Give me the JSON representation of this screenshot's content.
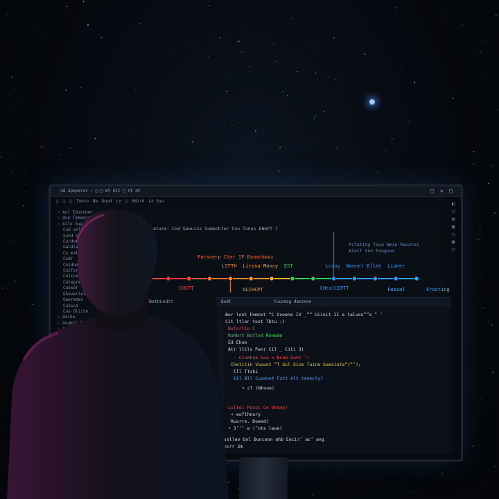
{
  "colors": {
    "background": "#05080d",
    "monitor_bg": "#0a0e15",
    "timeline_red": "#ff3b3b",
    "timeline_orange": "#ff8a2a",
    "timeline_green": "#2ed15a",
    "timeline_blue": "#2c9bff",
    "code_yellow": "#e8d24a",
    "code_green": "#48d66a",
    "code_red": "#ff4a4a",
    "code_blue": "#4fa6ff"
  },
  "window": {
    "title": "3d Spoperos  ‹  □  □ mt mit  □ nt mt",
    "controls": [
      "□",
      "✕",
      "□"
    ]
  },
  "toolbar": {
    "items": [
      "□",
      "□",
      "□",
      "Tooco",
      "Ba",
      "Buud",
      "Lo",
      "□",
      "Md/ch",
      "Lo Suu"
    ]
  },
  "tree": {
    "items": [
      "› Aul Idustnen",
      "› Uun Tomaers",
      "› Gilo Suar",
      "Cud selirs",
      "Sund Spoi",
      "Curdor",
      "Galdls",
      "Co mat",
      "Cudr",
      "Cuidoe",
      "Cuifore",
      "Cuirpas",
      "Catepre",
      "Cuoser",
      "Ghaveclet",
      "Gaeredes",
      "Cuisca",
      "Cuo Gliitn",
      "› Dalbe",
      "› Uuabtt Fiant",
      "› Cuin",
      "› Ludre"
    ]
  },
  "breadcrumb": "Feature: Cod  Gaouiss  Sumeohtor Cou  Tunes  EBAPT ]",
  "graph": {
    "title": "Fursoerp Cter  IF  Eunarkmaz",
    "note": [
      "Fstating Tsun Nmin Racotes",
      "Atalf Sun Fongnes"
    ],
    "nodes": [
      {
        "label": "",
        "color": "#ff3b3b"
      },
      {
        "label": "",
        "color": "#ff3b3b"
      },
      {
        "label": "",
        "color": "#ff5a3a"
      },
      {
        "label": "",
        "color": "#ff7a2a"
      },
      {
        "label": "LSTTH",
        "color": "#ff8a2a"
      },
      {
        "label": "Lirssa",
        "color": "#ff9a2a"
      },
      {
        "label": "Moncy",
        "color": "#ffb02a"
      },
      {
        "label": "EST",
        "color": "#2ed15a"
      },
      {
        "label": "",
        "color": "#2ed15a"
      },
      {
        "label": "Lcooy",
        "color": "#2c9bff"
      },
      {
        "label": "Nonnel",
        "color": "#2c9bff"
      },
      {
        "label": "Ellmt",
        "color": "#2c9bff"
      },
      {
        "label": "Lianer",
        "color": "#2c9bff"
      },
      {
        "label": "",
        "color": "#2cb0ff"
      }
    ],
    "sub_labels": {
      "left": "CHCPT",
      "mid": "ALCHCPT",
      "right": "CHtalCEPTT",
      "far_right": "Fossel",
      "edge": "Frosting"
    }
  },
  "left_panel": {
    "label": "Bathnndtt"
  },
  "code_panel": {
    "tabs": [
      "Bodt",
      "Fucomsg danzoon"
    ],
    "lines": [
      {
        "text": "Bor loot Fnmnot  “C Svoene IV _”“   Uiinit II e taluos””a_”  ’",
        "color": "#d8dfeb"
      },
      {
        "text": "Cit ltlor toot  Tbtu :)",
        "color": "#d8dfeb"
      },
      {
        "text": "Bulorllo C",
        "color": "#ff4a4a"
      },
      {
        "text": "Ruhbrt Botlod Ronede",
        "color": "#48d66a"
      },
      {
        "text": "Ed Ehoe",
        "color": "#d8dfeb"
      },
      {
        "text": "Atr ltils Pwnr  Cil  _  Citi     3)",
        "color": "#d8dfeb"
      },
      {
        "text": "· Cinehne Sus  =  bcan Sonr ’)",
        "color": "#ff4a4a"
      },
      {
        "text": "Chelilin Vuuunt “T Gcl Sine Tuine Soesiote”(“’);",
        "color": "#e8d24a"
      },
      {
        "text": "Cll  Ttshi",
        "color": "#d8dfeb"
      },
      {
        "text": "Etl  Nll  Cuoenet Fstt  Alt tenmcly)",
        "color": "#4fa6ff"
      },
      {
        "text": "• cl (Nhooe)",
        "color": "#d8dfeb"
      },
      {
        "text": "Lultel Psnct  Ce Onsmy)",
        "color": "#ff4a4a"
      },
      {
        "text": "•  eoflhnory",
        "color": "#d8dfeb"
      },
      {
        "text": "Ruorre.  Doeed)",
        "color": "#d8dfeb"
      },
      {
        "text": "• 3’’’ e  (’nts  leoe)",
        "color": "#d8dfeb"
      },
      {
        "text": "Bsslleo Ool Buncoon ahb Eecir’ ac’ ang",
        "color": "#d8dfeb"
      },
      {
        "text": "Docrr Sm",
        "color": "#d8dfeb"
      }
    ]
  },
  "scene": {
    "person": "person-silhouette",
    "monitor": "monitor"
  }
}
